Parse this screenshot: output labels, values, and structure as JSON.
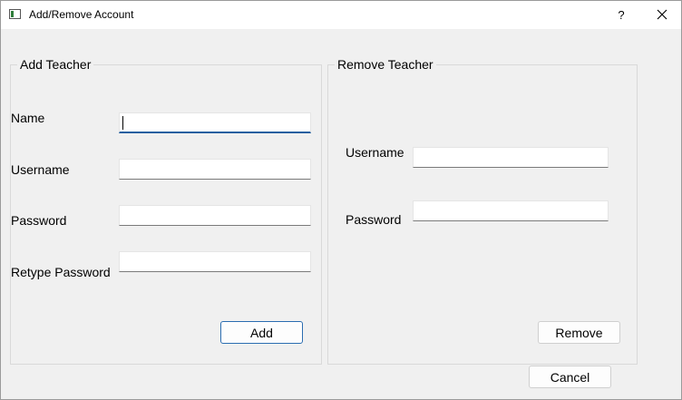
{
  "window": {
    "title": "Add/Remove Account",
    "help_label": "?"
  },
  "add_teacher": {
    "title": "Add Teacher",
    "name_label": "Name",
    "name_value": "",
    "username_label": "Username",
    "username_value": "",
    "password_label": "Password",
    "password_value": "",
    "retype_password_label": "Retype Password",
    "retype_password_value": "",
    "add_button": "Add"
  },
  "remove_teacher": {
    "title": "Remove Teacher",
    "username_label": "Username",
    "username_value": "",
    "password_label": "Password",
    "password_value": "",
    "remove_button": "Remove"
  },
  "footer": {
    "cancel_button": "Cancel"
  }
}
